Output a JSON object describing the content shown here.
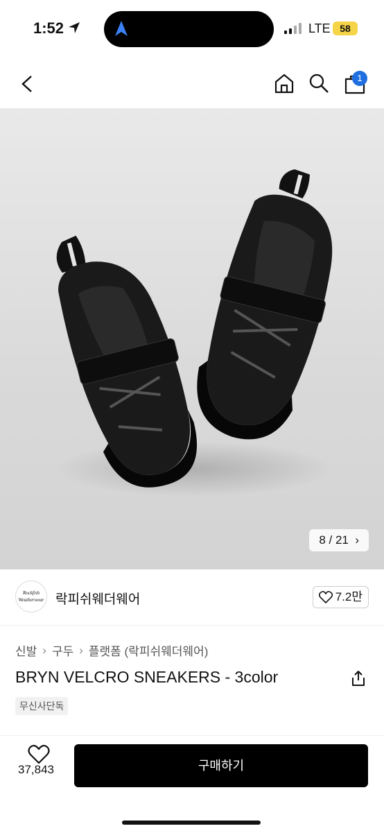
{
  "status_bar": {
    "time": "1:52",
    "network": "LTE",
    "battery": "58"
  },
  "nav": {
    "cart_count": "1"
  },
  "gallery": {
    "counter": "8 / 21"
  },
  "brand": {
    "name": "락피쉬웨더웨어",
    "logo_text": "Rockfish Weatherwear",
    "likes": "7.2만"
  },
  "breadcrumb": [
    "신발",
    "구두",
    "플랫폼 (락피쉬웨더웨어)"
  ],
  "product": {
    "title": "BRYN VELCRO SNEAKERS - 3color",
    "tag": "무신사단독"
  },
  "bottom_bar": {
    "like_count": "37,843",
    "buy_label": "구매하기"
  }
}
